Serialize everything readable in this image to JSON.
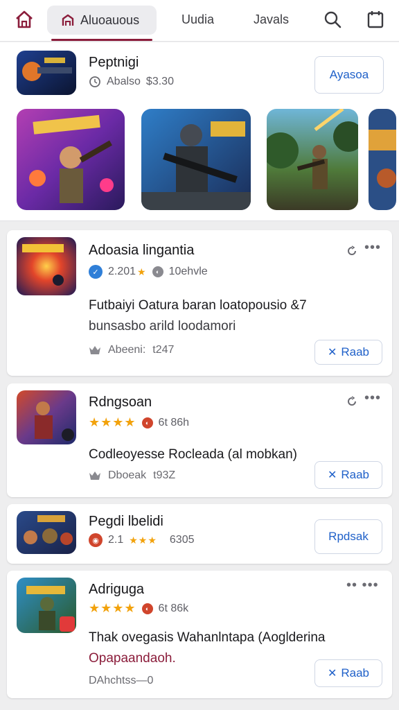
{
  "nav": {
    "tabs": [
      "Aluoauous",
      "Uudia",
      "Javals"
    ]
  },
  "featured": {
    "title": "Peptnigi",
    "meta": "Abalso",
    "price": "$3.30",
    "button": "Ayasoa"
  },
  "cards": [
    {
      "title": "Adoasia lingantia",
      "rating_text": "2.201",
      "installs": "10ehvle",
      "desc_line1": "Futbaiyi Oatura baran loatopousio &7",
      "desc_line2": "bunsasbo arild loodamori",
      "meta_label": "Abeeni:",
      "meta_value": "t247",
      "button": "Raab"
    },
    {
      "title": "Rdngsoan",
      "installs": "6t 86h",
      "desc_line1": "Codleoyesse Rocleada (al mobkan)",
      "meta_label": "Dboeak",
      "meta_value": "t93Z",
      "button": "Raab"
    },
    {
      "title": "Pegdi lbelidi",
      "rating_text": "2.1",
      "installs": "6305",
      "button": "Rpdsak"
    },
    {
      "title": "Adriguga",
      "installs": "6t 86k",
      "desc_line1": "Thak ovegasis Wahanlntapa (Aoglderina",
      "desc_line2": "Opapaandaoh.",
      "footer": "DAhchtss—0",
      "button": "Raab"
    }
  ],
  "colors": {
    "accent": "#8b1d3b",
    "link": "#2061c9",
    "star": "#f2a20c",
    "verified": "#2f7fd8",
    "badge_red": "#d0452c"
  }
}
